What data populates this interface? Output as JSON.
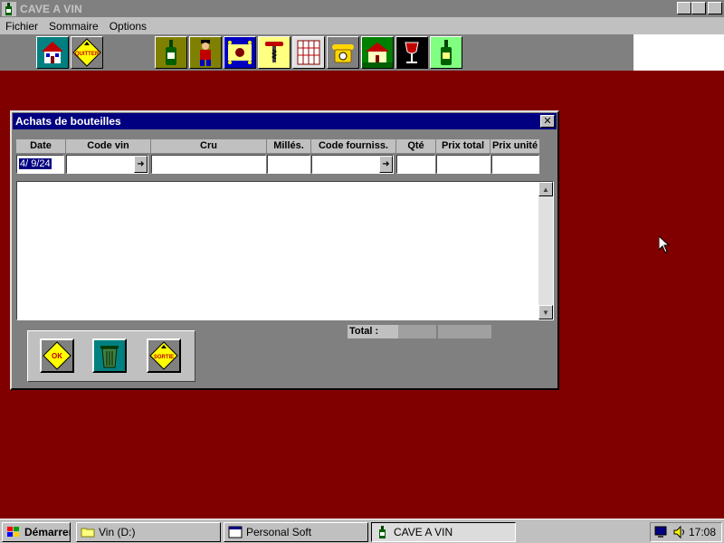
{
  "window": {
    "title": "CAVE A VIN"
  },
  "titlebar_buttons": {
    "minimize": "_",
    "maximize": "□",
    "close": "✕"
  },
  "menu": [
    {
      "label": "Fichier"
    },
    {
      "label": "Sommaire"
    },
    {
      "label": "Options"
    }
  ],
  "toolbar": {
    "tools": [
      {
        "icon": "house-icon"
      },
      {
        "icon": "quitter-sign-icon",
        "text": "QUITTER"
      },
      {
        "icon": "wine-bottle-icon"
      },
      {
        "icon": "sommelier-person-icon"
      },
      {
        "icon": "wine-label-icon"
      },
      {
        "icon": "corkscrew-icon"
      },
      {
        "icon": "wine-rack-icon"
      },
      {
        "icon": "telephone-icon"
      },
      {
        "icon": "chateau-icon"
      },
      {
        "icon": "wine-glass-icon"
      },
      {
        "icon": "bottle-label-icon"
      }
    ]
  },
  "dialog": {
    "title": "Achats de bouteilles",
    "columns": [
      {
        "label": "Date"
      },
      {
        "label": "Code vin"
      },
      {
        "label": "Cru"
      },
      {
        "label": "Millés."
      },
      {
        "label": "Code fourniss."
      },
      {
        "label": "Qté"
      },
      {
        "label": "Prix total"
      },
      {
        "label": "Prix unité"
      }
    ],
    "fields": {
      "date": "4/ 9/24",
      "code_vin": "",
      "cru": "",
      "milles": "",
      "code_fourniss": "",
      "qte": "",
      "prix_total": "",
      "prix_unite": ""
    },
    "list_rows": [],
    "total_label": "Total :",
    "total_values": [
      "",
      ""
    ],
    "buttons": {
      "ok": "OK",
      "delete_icon": "trash-can-icon",
      "sortie": "SORTIE"
    }
  },
  "taskbar": {
    "start": "Démarrer",
    "tasks": [
      {
        "label": "Vin (D:)",
        "icon": "folder-icon"
      },
      {
        "label": "Personal Soft",
        "icon": "window-icon"
      },
      {
        "label": "CAVE A VIN",
        "icon": "wine-bottle-icon",
        "active": true
      }
    ],
    "clock": "17:08"
  },
  "colors": {
    "desktop": "#800000",
    "title_active": "#000080",
    "face": "#c0c0c0",
    "toolbar": "#808080"
  }
}
